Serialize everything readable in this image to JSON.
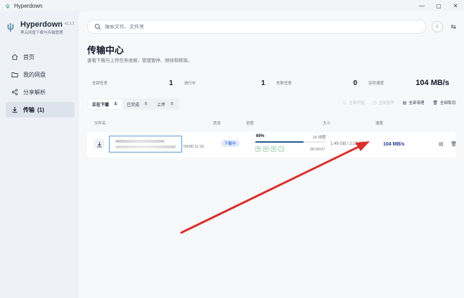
{
  "window": {
    "title": "Hyperdown",
    "controls": [
      "—",
      "▢",
      "✕"
    ]
  },
  "brand": {
    "name": "Hyperdown",
    "version": "v1.1.1",
    "subtitle": "黑云网盘下载与传输管理"
  },
  "nav": [
    {
      "label": "首页",
      "icon": "home-icon"
    },
    {
      "label": "我的网盘",
      "icon": "folder-icon"
    },
    {
      "label": "分享解析",
      "icon": "share-icon"
    },
    {
      "label": "传输",
      "icon": "download-icon",
      "count": "(1)",
      "active": true
    }
  ],
  "search": {
    "placeholder": "搜索文件、文件夹"
  },
  "user": {
    "avatar": "L"
  },
  "page": {
    "title": "传输中心",
    "description": "查看下载与上传任务进展，管理暂停、继续和移除。"
  },
  "stats": [
    {
      "label": "全部任务",
      "value": "1"
    },
    {
      "label": "进行中",
      "value": "1"
    },
    {
      "label": "失败任务",
      "value": "0"
    },
    {
      "label": "实时速度",
      "value": "104 MB/s"
    }
  ],
  "tabs": [
    {
      "label": "正在下载",
      "count": "1",
      "active": true
    },
    {
      "label": "已完成",
      "count": "0"
    },
    {
      "label": "上传",
      "count": "0"
    }
  ],
  "actions": [
    {
      "label": "全部开始",
      "icon": "play-icon",
      "disabled": true
    },
    {
      "label": "全部暂停",
      "icon": "pause-icon",
      "disabled": true
    },
    {
      "label": "全部清理",
      "icon": "clear-icon",
      "disabled": false
    },
    {
      "label": "全部取消",
      "icon": "trash-icon",
      "disabled": false
    }
  ],
  "columns": {
    "name": "文件名",
    "status": "状态",
    "progress": "进度",
    "size": "大小",
    "speed": "速度"
  },
  "rows": [
    {
      "date": "09/08 11:18",
      "status": "下载中",
      "progress_percent": "69%",
      "progress_value": 0.69,
      "threads": "16 线程",
      "eta": "00:00:07",
      "size": "1.49 GB / 2.15 GB",
      "speed": "104 MB/s"
    }
  ],
  "colors": {
    "accent": "#1f5b8c",
    "status_bg": "#e0ecfb",
    "annotation_arrow": "#d9302c"
  }
}
